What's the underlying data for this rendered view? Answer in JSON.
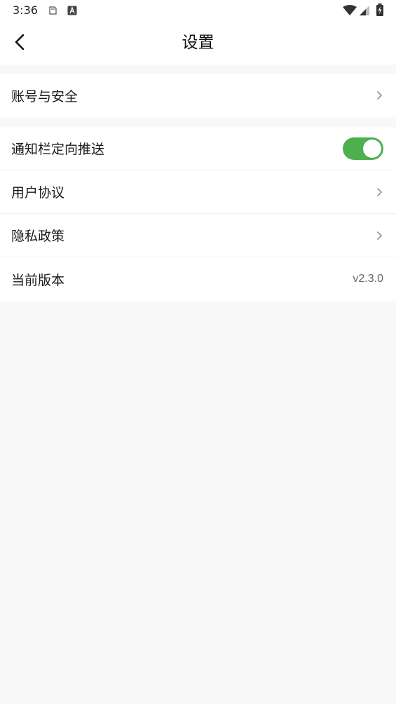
{
  "status_bar": {
    "time": "3:36",
    "icons": [
      "clipboard-icon",
      "font-a-icon",
      "wifi-icon",
      "cell-signal-icon",
      "battery-charging-icon"
    ]
  },
  "header": {
    "title": "设置",
    "back_icon": "chevron-left-icon"
  },
  "groups": [
    {
      "items": [
        {
          "label": "账号与安全",
          "trailing": "chevron-right-icon"
        }
      ]
    },
    {
      "items": [
        {
          "label": "通知栏定向推送",
          "trailing": "toggle",
          "toggle_on": true
        },
        {
          "label": "用户协议",
          "trailing": "chevron-right-icon"
        },
        {
          "label": "隐私政策",
          "trailing": "chevron-right-icon"
        },
        {
          "label": "当前版本",
          "value": "v2.3.0"
        }
      ]
    }
  ],
  "colors": {
    "toggle_on": "#4cb04f",
    "background": "#f8f8f8",
    "surface": "#ffffff"
  }
}
